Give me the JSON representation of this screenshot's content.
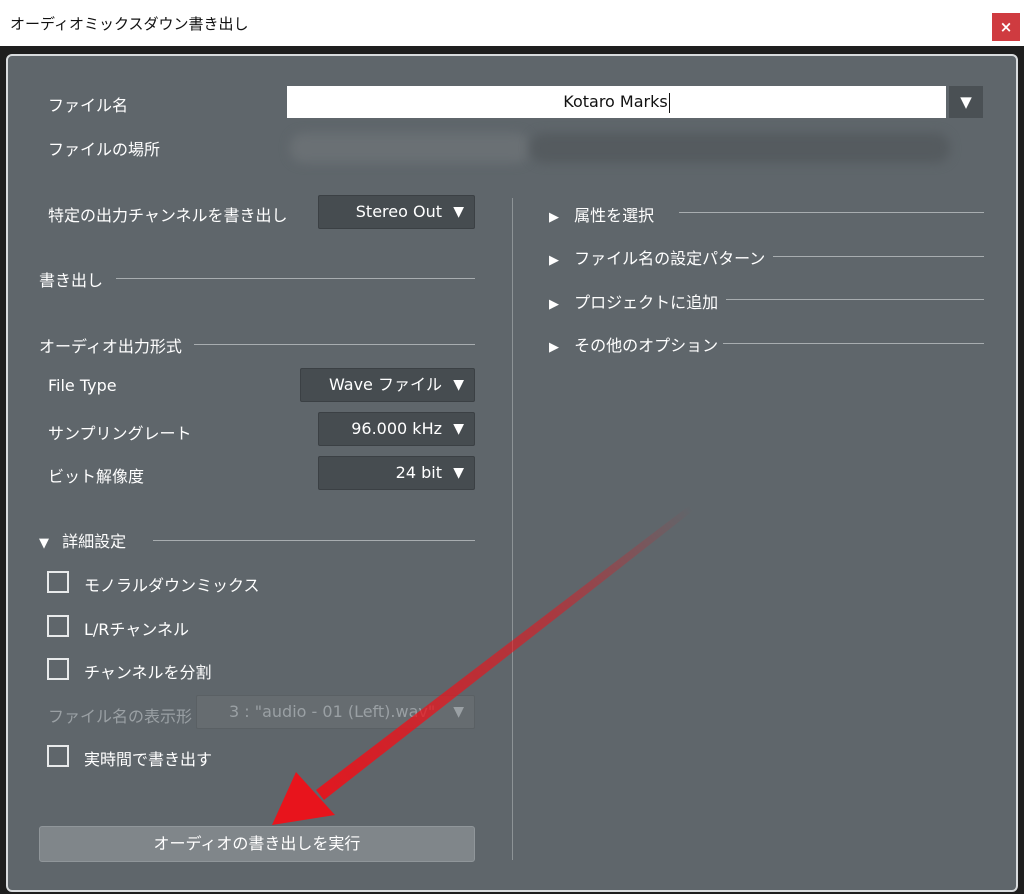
{
  "window": {
    "title": "オーディオミックスダウン書き出し",
    "close_glyph": "×"
  },
  "file": {
    "name_label": "ファイル名",
    "name_value": "Kotaro Marks",
    "dropdown_glyph": "▼",
    "location_label": "ファイルの場所"
  },
  "channel": {
    "label": "特定の出力チャンネルを書き出し",
    "value": "Stereo Out"
  },
  "sections": {
    "export": "書き出し",
    "audio_format": "オーディオ出力形式",
    "advanced": "詳細設定"
  },
  "format": {
    "file_type_label": "File Type",
    "file_type_value": "Wave ファイル",
    "sample_rate_label": "サンプリングレート",
    "sample_rate_value": "96.000 kHz",
    "bit_depth_label": "ビット解像度",
    "bit_depth_value": "24 bit"
  },
  "advanced": {
    "options": [
      {
        "label": "モノラルダウンミックス",
        "checked": false
      },
      {
        "label": "L/Rチャンネル",
        "checked": false
      },
      {
        "label": "チャンネルを分割",
        "checked": false
      }
    ],
    "filename_display_label": "ファイル名の表示形",
    "filename_display_value": "3 : \"audio - 01 (Left).wav\"",
    "realtime_label": "実時間で書き出す"
  },
  "right_panel": {
    "items": [
      "属性を選択",
      "ファイル名の設定パターン",
      "プロジェクトに追加",
      "その他のオプション"
    ]
  },
  "actions": {
    "export_button": "オーディオの書き出しを実行"
  },
  "icons": {
    "expand_right": "▶",
    "expand_down": "▼",
    "dropdown": "▼"
  },
  "colors": {
    "panel_bg": "#5f666b",
    "select_bg": "#464c50",
    "close_red": "#cf3b40",
    "annotation_arrow": "#e8141c"
  }
}
